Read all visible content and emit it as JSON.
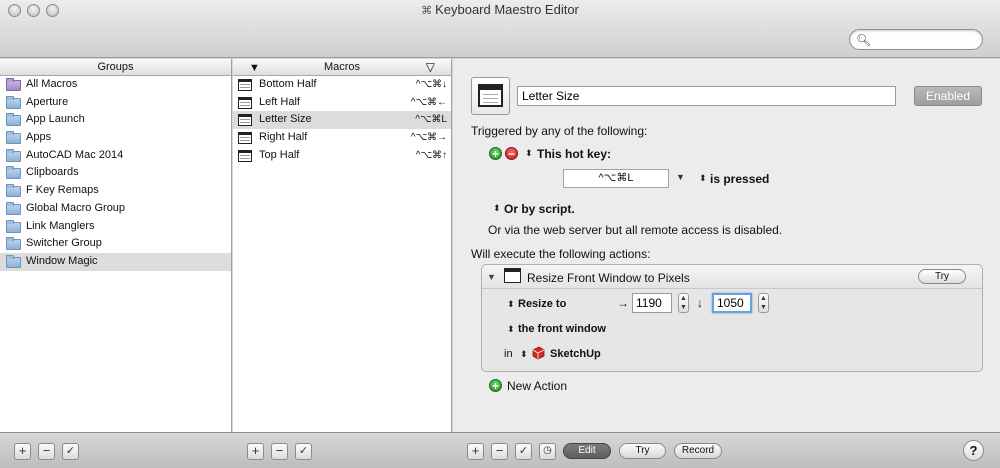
{
  "window": {
    "title": "Keyboard Maestro Editor",
    "title_prefix": "⌘"
  },
  "search": {
    "placeholder": "",
    "value": ""
  },
  "groups": {
    "header": "Groups",
    "items": [
      {
        "label": "All Macros",
        "smart": true
      },
      {
        "label": "Aperture"
      },
      {
        "label": "App Launch"
      },
      {
        "label": "Apps"
      },
      {
        "label": "AutoCAD Mac 2014"
      },
      {
        "label": "Clipboards"
      },
      {
        "label": "F Key Remaps"
      },
      {
        "label": "Global Macro Group"
      },
      {
        "label": "Link Manglers"
      },
      {
        "label": "Switcher Group"
      },
      {
        "label": "Window Magic",
        "selected": true
      }
    ]
  },
  "macros": {
    "header": "Macros",
    "items": [
      {
        "label": "Bottom Half",
        "hotkey": "^⌥⌘↓"
      },
      {
        "label": "Left Half",
        "hotkey": "^⌥⌘←"
      },
      {
        "label": "Letter Size",
        "hotkey": "^⌥⌘L",
        "selected": true
      },
      {
        "label": "Right Half",
        "hotkey": "^⌥⌘→"
      },
      {
        "label": "Top Half",
        "hotkey": "^⌥⌘↑"
      }
    ]
  },
  "editor": {
    "macro_name": "Letter Size",
    "enabled_label": "Enabled",
    "triggered_label": "Triggered by any of the following:",
    "hotkey_trigger_label": "This hot key:",
    "hotkey_value": "^⌥⌘L",
    "is_pressed_label": "is pressed",
    "or_by_script": "Or by script.",
    "web_server_note": "Or via the web server but all remote access is disabled.",
    "will_execute_label": "Will execute the following actions:",
    "action": {
      "title": "Resize Front Window to Pixels",
      "try_label": "Try",
      "resize_to_label": "Resize to",
      "width_arrow": "→",
      "width_value": "1190",
      "height_arrow": "↓",
      "height_value": "1050",
      "target_label": "the front window",
      "in_label": "in",
      "app_label": "SketchUp"
    },
    "new_action_label": "New Action"
  },
  "bottom_bar": {
    "edit_label": "Edit",
    "try_label": "Try",
    "record_label": "Record",
    "help_label": "?"
  }
}
